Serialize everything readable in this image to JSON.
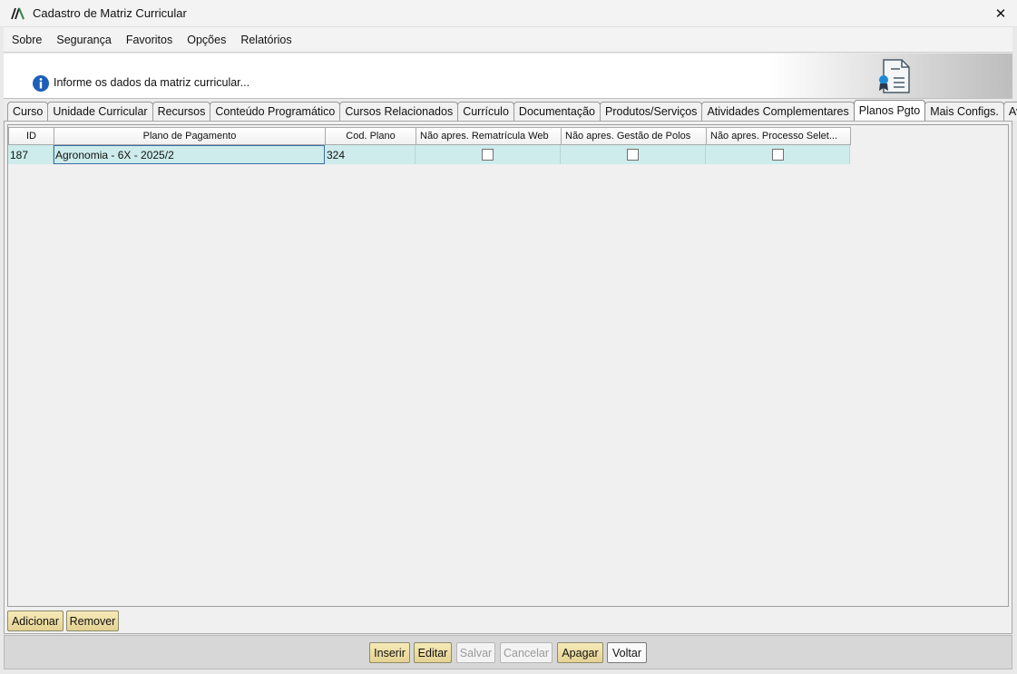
{
  "window": {
    "title": "Cadastro de Matriz Curricular",
    "close_symbol": "✕"
  },
  "menu": [
    "Sobre",
    "Segurança",
    "Favoritos",
    "Opções",
    "Relatórios"
  ],
  "info": {
    "message": "Informe os dados da matriz curricular...",
    "icon": "info-icon",
    "badge_icon": "certificate-icon"
  },
  "tabs": [
    "Curso",
    "Unidade Curricular",
    "Recursos",
    "Conteúdo Programático",
    "Cursos Relacionados",
    "Currículo",
    "Documentação",
    "Produtos/Serviços",
    "Atividades Complementares",
    "Planos Pgto",
    "Mais Configs.",
    "AvaliA"
  ],
  "active_tab": "Planos Pgto",
  "grid": {
    "columns": [
      "ID",
      "Plano de Pagamento",
      "Cod. Plano",
      "Não apres. Rematrícula Web",
      "Não apres. Gestão de Polos",
      "Não apres. Processo Selet..."
    ],
    "rows": [
      {
        "id": "187",
        "plano": "Agronomia - 6X - 2025/2",
        "cod_plano": "324",
        "nao_apres_rematricula_web": false,
        "nao_apres_gestao_polos": false,
        "nao_apres_processo_seletivo": false
      }
    ],
    "row_highlight_color": "#cdeceb"
  },
  "grid_buttons": {
    "add": "Adicionar",
    "remove": "Remover"
  },
  "footer_buttons": {
    "insert": "Inserir",
    "edit": "Editar",
    "save": "Salvar",
    "cancel": "Cancelar",
    "delete": "Apagar",
    "back": "Voltar"
  },
  "colors": {
    "button_bg": "#e9d89c",
    "info_blue": "#1c5fb8",
    "selection_border": "#3a6ea5"
  }
}
